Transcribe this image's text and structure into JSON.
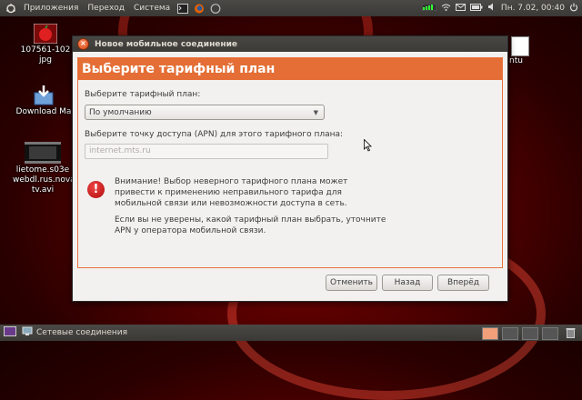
{
  "top_panel": {
    "menu_applications": "Приложения",
    "menu_places": "Переход",
    "menu_system": "Система",
    "clock": "Пн. 7.02, 00:40"
  },
  "desktop": {
    "icon1_label": "107561-102\njpg",
    "icon2_label": "Download Ma",
    "icon3_label": "lietome.s03e\nwebdl.rus.nova\ntv.avi",
    "right_label": "ntu"
  },
  "dialog": {
    "title": "Новое мобильное соединение",
    "header": "Выберите тарифный план",
    "plan_label": "Выберите тарифный план:",
    "plan_selected": "По умолчанию",
    "apn_label": "Выберите точку доступа (APN) для этого тарифного плана:",
    "apn_value": "internet.mts.ru",
    "warning_p1": "Внимание! Выбор неверного тарифного плана может привести к применению неправильного тарифа для мобильной связи или невозможности доступа в сеть.",
    "warning_p2": "Если вы не уверены, какой тарифный план выбрать, уточните APN у оператора мобильной связи.",
    "btn_cancel": "Отменить",
    "btn_back": "Назад",
    "btn_forward": "Вперёд"
  },
  "bottom_panel": {
    "task_label": "Сетевые соединения"
  },
  "colors": {
    "accent": "#e46e35",
    "panel": "#3c3b37",
    "desktop": "#5a0000"
  }
}
